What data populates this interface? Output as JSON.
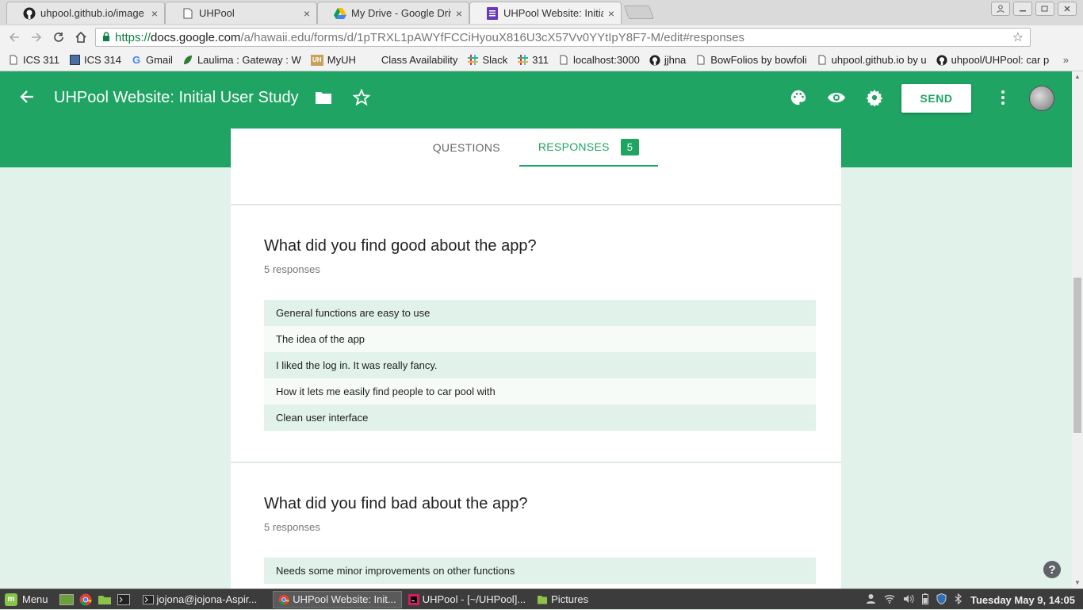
{
  "browser": {
    "tabs": [
      {
        "title": "uhpool.github.io/image",
        "icon": "github-icon"
      },
      {
        "title": "UHPool",
        "icon": "page-icon"
      },
      {
        "title": "My Drive - Google Drive",
        "icon": "google-drive-icon"
      },
      {
        "title": "UHPool Website: Initial",
        "icon": "google-forms-icon"
      }
    ],
    "close_glyph": "×",
    "url_scheme": "https://",
    "url_host": "docs.google.com",
    "url_path": "/a/hawaii.edu/forms/d/1pTRXL1pAWYfFCCiHyouX816U3cX57Vv0YYtIpY8F7-M/edit#responses",
    "bookmarks": [
      {
        "label": "ICS 311",
        "icon": "page-icon"
      },
      {
        "label": "ICS 314",
        "icon": "square-icon"
      },
      {
        "label": "Gmail",
        "icon": "google-icon"
      },
      {
        "label": "Laulima : Gateway : W",
        "icon": "laulima-icon"
      },
      {
        "label": "MyUH",
        "icon": "uh-icon"
      },
      {
        "label": "Class Availability",
        "icon": "blank-icon"
      },
      {
        "label": "Slack",
        "icon": "slack-icon"
      },
      {
        "label": "311",
        "icon": "slack-icon"
      },
      {
        "label": "localhost:3000",
        "icon": "page-icon"
      },
      {
        "label": "jjhna",
        "icon": "github-icon"
      },
      {
        "label": "BowFolios by bowfoli",
        "icon": "page-icon"
      },
      {
        "label": "uhpool.github.io by u",
        "icon": "page-icon"
      },
      {
        "label": "uhpool/UHPool: car p",
        "icon": "github-icon"
      }
    ],
    "bookmarks_more": "»"
  },
  "form": {
    "title": "UHPool Website: Initial User Study",
    "send_label": "SEND",
    "tabs": {
      "questions": "QUESTIONS",
      "responses": "RESPONSES",
      "response_count": "5"
    },
    "questions": [
      {
        "title": "What did you find good about the app?",
        "count": "5 responses",
        "answers": [
          "General functions are easy to use",
          "The idea of the app",
          "I liked the log in. It was really fancy.",
          "How it lets me easily find people to car pool with",
          "Clean user interface"
        ]
      },
      {
        "title": "What did you find bad about the app?",
        "count": "5 responses",
        "answers": [
          "Needs some minor improvements on other functions"
        ]
      }
    ],
    "accent_color": "#1fa463"
  },
  "taskbar": {
    "menu_label": "Menu",
    "windows": [
      {
        "label": "jojona@jojona-Aspir...",
        "icon": "terminal-icon",
        "active": false
      },
      {
        "label": "UHPool Website: Init...",
        "icon": "chrome-icon",
        "active": true
      },
      {
        "label": "UHPool - [~/UHPool]...",
        "icon": "intellij-icon",
        "active": false
      },
      {
        "label": "Pictures",
        "icon": "folder-icon",
        "active": false
      }
    ],
    "clock": "Tuesday May  9, 14:05"
  }
}
